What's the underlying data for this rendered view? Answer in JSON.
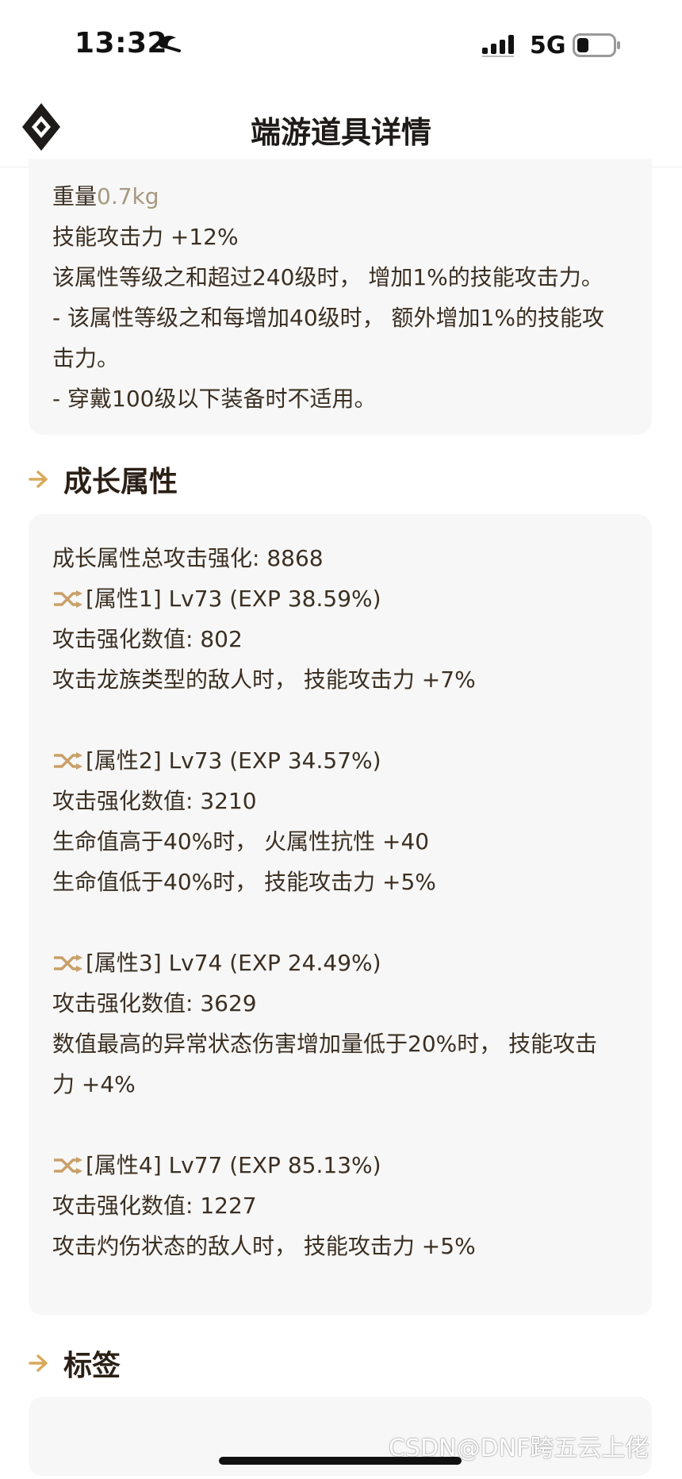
{
  "status_bar": {
    "time": "13:32",
    "network": "5G",
    "icons": [
      "sleep-mode-icon",
      "cellular-signal-icon",
      "battery-icon"
    ]
  },
  "header": {
    "title": "端游道具详情",
    "logo_icon": "diamond-logo-icon"
  },
  "basic_card": {
    "weight_label": "重量",
    "weight_value": "0.7kg",
    "lines": [
      "技能攻击力 +12%",
      "该属性等级之和超过240级时， 增加1%的技能攻击力。",
      "- 该属性等级之和每增加40级时， 额外增加1%的技能攻",
      "击力。",
      "- 穿戴100级以下装备时不适用。"
    ]
  },
  "growth_section": {
    "title": "成长属性",
    "total": "成长属性总攻击强化: 8868",
    "attributes": [
      {
        "header": "[属性1] Lv73 (EXP 38.59%)",
        "lines": [
          "攻击强化数值:  802",
          "攻击龙族类型的敌人时， 技能攻击力 +7%"
        ]
      },
      {
        "header": "[属性2] Lv73 (EXP 34.57%)",
        "lines": [
          "攻击强化数值:  3210",
          "生命值高于40%时， 火属性抗性 +40",
          "生命值低于40%时， 技能攻击力 +5%"
        ]
      },
      {
        "header": "[属性3] Lv74 (EXP 24.49%)",
        "lines": [
          "攻击强化数值:  3629",
          "数值最高的异常状态伤害增加量低于20%时， 技能攻击",
          "力 +4%"
        ]
      },
      {
        "header": "[属性4] Lv77 (EXP 85.13%)",
        "lines": [
          "攻击强化数值:  1227",
          "攻击灼伤状态的敌人时， 技能攻击力 +5%"
        ]
      }
    ]
  },
  "tags_section": {
    "title": "标签"
  },
  "watermark": "CSDN@DNF跨五云上佬",
  "colors": {
    "accent": "#d9a95b",
    "text": "#3b2f22",
    "muted": "#a79880",
    "card_bg": "#f7f7f7"
  }
}
